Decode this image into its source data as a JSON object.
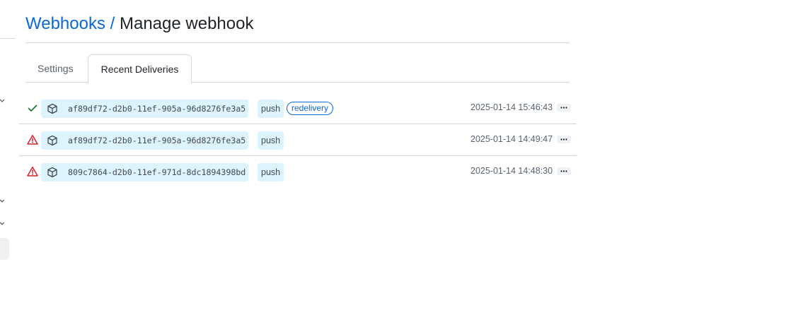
{
  "breadcrumb": {
    "parent": "Webhooks",
    "separator": "/",
    "current": "Manage webhook"
  },
  "tabs": [
    {
      "label": "Settings",
      "selected": false
    },
    {
      "label": "Recent Deliveries",
      "selected": true
    }
  ],
  "deliveries": [
    {
      "status": "success",
      "status_icon": "check-icon",
      "guid": "af89df72-d2b0-11ef-905a-96d8276fe3a5",
      "event": "push",
      "badge": "redelivery",
      "timestamp": "2025-01-14 15:46:43"
    },
    {
      "status": "failed",
      "status_icon": "alert-icon",
      "guid": "af89df72-d2b0-11ef-905a-96d8276fe3a5",
      "event": "push",
      "timestamp": "2025-01-14 14:49:47"
    },
    {
      "status": "failed",
      "status_icon": "alert-icon",
      "guid": "809c7864-d2b0-11ef-971d-8dc1894398bd",
      "event": "push",
      "timestamp": "2025-01-14 14:48:30"
    }
  ],
  "colors": {
    "link": "#0969da",
    "success": "#1a7f37",
    "danger": "#d1242f",
    "pill_bg": "#ddf4ff",
    "border": "#d1d9e0"
  }
}
